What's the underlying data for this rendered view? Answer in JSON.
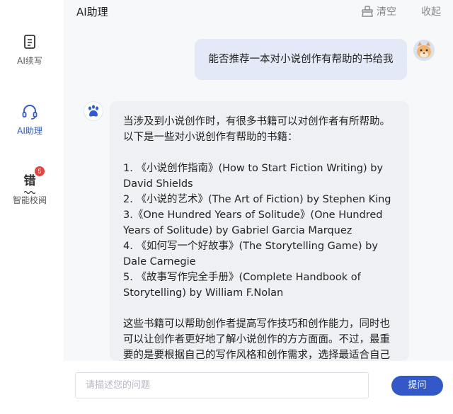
{
  "sidebar": {
    "items": [
      {
        "label": "AI续写",
        "icon": "document-icon"
      },
      {
        "label": "AI助理",
        "icon": "headset-icon",
        "active": true
      },
      {
        "label": "智能校阅",
        "icon": "proofread-icon",
        "badge": "5",
        "glyph": "错"
      }
    ]
  },
  "header": {
    "title": "AI助理",
    "clear_label": "清空",
    "collapse_label": "收起"
  },
  "chat": {
    "user_message": "能否推荐一本对小说创作有帮助的书给我",
    "bot_paragraphs": [
      "当涉及到小说创作时，有很多书籍可以对创作者有所帮助。以下是一些对小说创作有帮助的书籍：",
      "",
      "1. 《小说创作指南》(How to Start Fiction Writing) by David Shields",
      "2. 《小说的艺术》(The Art of Fiction) by Stephen King",
      "3.《One Hundred Years of Solitude》(One Hundred Years of Solitude) by Gabriel Garcia Marquez",
      "4. 《如何写一个好故事》(The Storytelling Game) by Dale Carnegie",
      "5. 《故事写作完全手册》(Complete Handbook of Storytelling) by William F.Nolan",
      "",
      "这些书籍可以帮助创作者提高写作技巧和创作能力，同时也可以让创作者更好地了解小说创作的方方面面。不过，最重要的是要根据自己的写作风格和创作需求，选择最适合自己的书籍。"
    ]
  },
  "composer": {
    "placeholder": "请描述您的问题",
    "submit_label": "提问"
  }
}
